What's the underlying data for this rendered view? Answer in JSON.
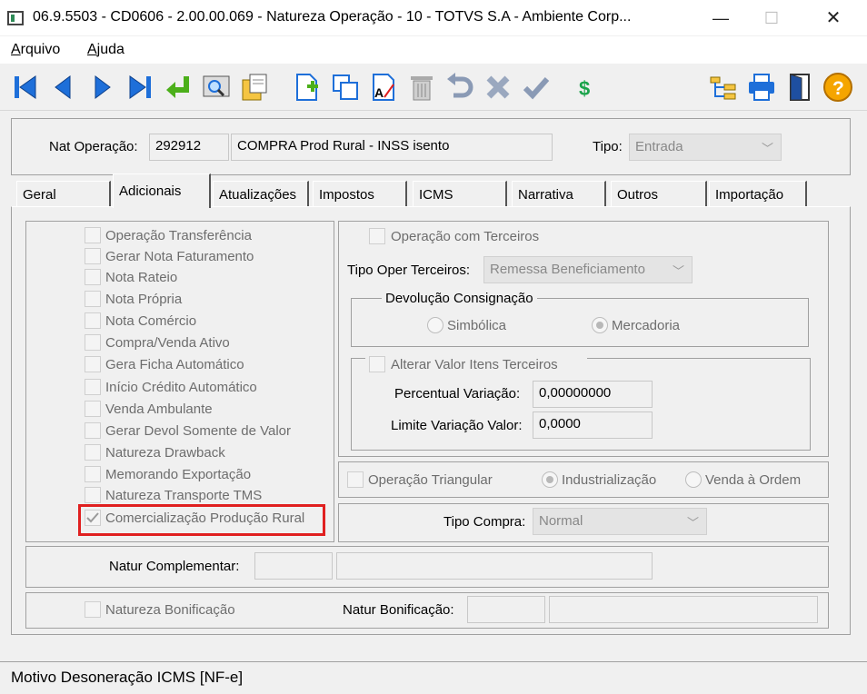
{
  "window": {
    "title": "06.9.5503 - CD0606 - 2.00.00.069 - Natureza Operação - 10 - TOTVS S.A - Ambiente Corp...",
    "minimize": "—",
    "maximize": "☐",
    "close": "✕"
  },
  "menu": {
    "arquivo_first": "A",
    "arquivo_rest": "rquivo",
    "ajuda_first": "A",
    "ajuda_rest": "juda"
  },
  "header": {
    "nat_label": "Nat Operação:",
    "nat_code": "292912",
    "nat_desc": "COMPRA Prod Rural - INSS isento",
    "tipo_label": "Tipo:",
    "tipo_value": "Entrada"
  },
  "tabs": [
    {
      "label": "Geral"
    },
    {
      "label": "Adicionais"
    },
    {
      "label": "Atualizações"
    },
    {
      "label": "Impostos"
    },
    {
      "label": "ICMS"
    },
    {
      "label": "Narrativa"
    },
    {
      "label": "Outros"
    },
    {
      "label": "Importação"
    }
  ],
  "checks": [
    "Operação Transferência",
    "Gerar Nota Faturamento",
    "Nota Rateio",
    "Nota Própria",
    "Nota Comércio",
    "Compra/Venda Ativo",
    "Gera Ficha Automático",
    "Início Crédito Automático",
    "Venda Ambulante",
    "Gerar Devol Somente de Valor",
    "Natureza Drawback",
    "Memorando Exportação",
    "Natureza Transporte TMS",
    "Comercialização Produção Rural"
  ],
  "terceiros": {
    "op_label": "Operação com Terceiros",
    "tipo_label": "Tipo Oper Terceiros:",
    "tipo_value": "Remessa Beneficiamento",
    "devol_legend": "Devolução Consignação",
    "simbolica": "Simbólica",
    "mercadoria": "Mercadoria",
    "alterar_label": "Alterar Valor Itens Terceiros",
    "perc_label": "Percentual Variação:",
    "perc_value": "0,00000000",
    "limite_label": "Limite Variação Valor:",
    "limite_value": "0,0000"
  },
  "triangular": {
    "op_label": "Operação Triangular",
    "industrializacao": "Industrialização",
    "venda_ordem": "Venda à Ordem"
  },
  "compra": {
    "label": "Tipo Compra:",
    "value": "Normal"
  },
  "complementar": {
    "label": "Natur Complementar:"
  },
  "bonificacao": {
    "check_label": "Natureza Bonificação",
    "label": "Natur Bonificação:"
  },
  "status": {
    "text": "Motivo Desoneração ICMS [NF-e]"
  },
  "colors": {
    "highlight": "#e02020",
    "toolbar_blue": "#1e6fd9"
  }
}
